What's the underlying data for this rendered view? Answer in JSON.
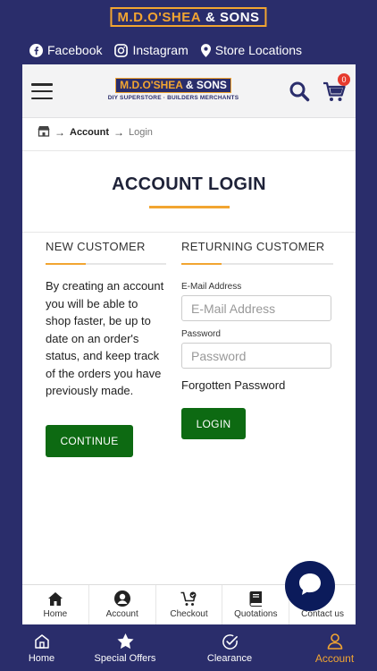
{
  "brand": {
    "part1": "M.D.O'SHEA",
    "part2": "& SONS",
    "tagline": "DIY SUPERSTORE · BUILDERS MERCHANTS"
  },
  "social": [
    {
      "label": "Facebook",
      "icon": "facebook-icon"
    },
    {
      "label": "Instagram",
      "icon": "instagram-icon"
    },
    {
      "label": "Store Locations",
      "icon": "location-pin-icon"
    }
  ],
  "header": {
    "cart_count": "0"
  },
  "breadcrumb": {
    "current": "Account",
    "page": "Login"
  },
  "page_title": "ACCOUNT LOGIN",
  "new_customer": {
    "heading": "NEW CUSTOMER",
    "body": "By creating an account you will be able to shop faster, be up to date on an order's status, and keep track of the orders you have previously made.",
    "button": "CONTINUE"
  },
  "returning_customer": {
    "heading": "RETURNING CUSTOMER",
    "email_label": "E-Mail Address",
    "email_placeholder": "E-Mail Address",
    "password_label": "Password",
    "password_placeholder": "Password",
    "forgot": "Forgotten Password",
    "button": "LOGIN"
  },
  "inpage_nav": [
    {
      "label": "Home",
      "icon": "home-icon"
    },
    {
      "label": "Account",
      "icon": "user-circle-icon"
    },
    {
      "label": "Checkout",
      "icon": "cart-check-icon"
    },
    {
      "label": "Quotations",
      "icon": "book-icon"
    },
    {
      "label": "Contact us",
      "icon": "contact-icon"
    }
  ],
  "tabbar": [
    {
      "label": "Home",
      "icon": "home-outline-icon",
      "active": false
    },
    {
      "label": "Special Offers",
      "icon": "star-icon",
      "active": false
    },
    {
      "label": "Clearance",
      "icon": "check-circle-icon",
      "active": false
    },
    {
      "label": "Account",
      "icon": "person-icon",
      "active": true
    }
  ],
  "colors": {
    "navy": "#2a2d6b",
    "accent": "#f2a531",
    "green": "#0d6a12",
    "badge": "#e63a2e"
  }
}
